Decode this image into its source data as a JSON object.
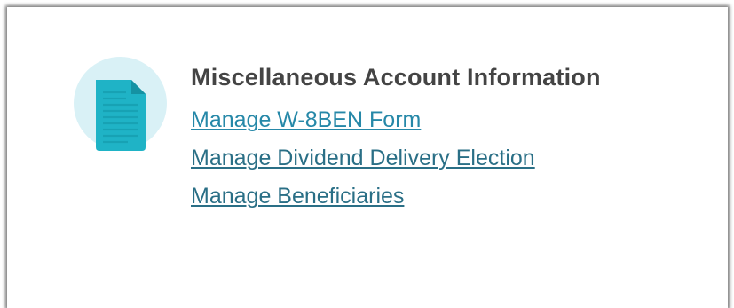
{
  "section": {
    "title": "Miscellaneous Account Information",
    "icon": "document-icon",
    "links": [
      {
        "label": "Manage W-8BEN Form",
        "name": "manage-w8ben-form-link"
      },
      {
        "label": "Manage Dividend Delivery Election",
        "name": "manage-dividend-delivery-election-link"
      },
      {
        "label": "Manage Beneficiaries",
        "name": "manage-beneficiaries-link"
      }
    ]
  },
  "colors": {
    "accent": "#1fb3c6",
    "icon_bg": "#d9f1f6",
    "title": "#444444",
    "link": "#2a6f86"
  }
}
